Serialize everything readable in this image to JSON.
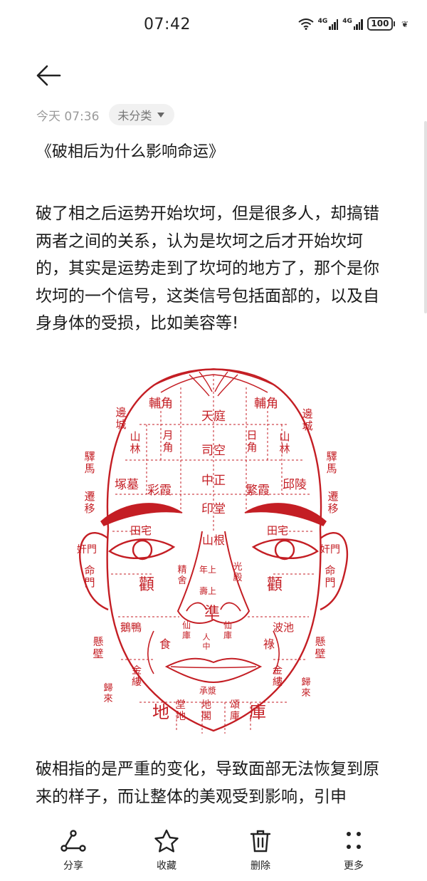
{
  "status_bar": {
    "time": "07:42",
    "network_1": "4G",
    "network_2": "4G",
    "battery": "100",
    "icons": [
      "wifi-icon",
      "signal-icon",
      "signal-icon",
      "battery-icon",
      "leaf-icon"
    ]
  },
  "header": {
    "back_icon": "arrow-left-icon"
  },
  "meta": {
    "timestamp": "今天 07:36",
    "category": "未分类"
  },
  "note": {
    "title": "《破相后为什么影响命运》",
    "paragraph_1": "破了相之后运势开始坎坷，但是很多人，却搞错两者之间的关系，认为是坎坷之后才开始坎坷的，其实是运势走到了坎坷的地方了，那个是你坎坷的一个信号，这类信号包括面部的，以及自身身体的受损，比如美容等!",
    "paragraph_2": "破相指的是严重的变化，导致面部无法恢复到原来的样子，而让整体的美观受到影响，引申",
    "face_chart": {
      "accent_color": "#c41e24",
      "labels": [
        {
          "id": "fujiao-l",
          "text": "輔角"
        },
        {
          "id": "fujiao-r",
          "text": "輔角"
        },
        {
          "id": "biancheng-l",
          "text": "邊城"
        },
        {
          "id": "biancheng-r",
          "text": "邊城"
        },
        {
          "id": "tianting",
          "text": "天庭"
        },
        {
          "id": "shanlin-l",
          "text": "山林"
        },
        {
          "id": "shanlin-r",
          "text": "山林"
        },
        {
          "id": "yuejiao",
          "text": "月角"
        },
        {
          "id": "rijiao",
          "text": "日角"
        },
        {
          "id": "sikong",
          "text": "司空"
        },
        {
          "id": "yima-l",
          "text": "驛馬"
        },
        {
          "id": "yima-r",
          "text": "驛馬"
        },
        {
          "id": "zhongzheng",
          "text": "中正"
        },
        {
          "id": "zhongmu",
          "text": "塚墓"
        },
        {
          "id": "caixia",
          "text": "彩霞"
        },
        {
          "id": "fanxia",
          "text": "繁霞"
        },
        {
          "id": "qiuling",
          "text": "邱陵"
        },
        {
          "id": "qianyi-l",
          "text": "遷移"
        },
        {
          "id": "qianyi-r",
          "text": "遷移"
        },
        {
          "id": "yintang",
          "text": "印堂"
        },
        {
          "id": "tianzhai-l",
          "text": "田宅"
        },
        {
          "id": "tianzhai-r",
          "text": "田宅"
        },
        {
          "id": "shangen",
          "text": "山根"
        },
        {
          "id": "jianmen-l",
          "text": "奸門"
        },
        {
          "id": "jianmen-r",
          "text": "奸門"
        },
        {
          "id": "nianshang",
          "text": "年上"
        },
        {
          "id": "shoushang",
          "text": "壽上"
        },
        {
          "id": "jingshe",
          "text": "精舍"
        },
        {
          "id": "guangdian",
          "text": "光殿"
        },
        {
          "id": "quan-l",
          "text": "顴"
        },
        {
          "id": "quan-r",
          "text": "顴"
        },
        {
          "id": "mingmen-l",
          "text": "命門"
        },
        {
          "id": "mingmen-r",
          "text": "命門"
        },
        {
          "id": "zhun",
          "text": "準"
        },
        {
          "id": "eya",
          "text": "鵝鴨"
        },
        {
          "id": "bochi",
          "text": "波池"
        },
        {
          "id": "shi",
          "text": "食"
        },
        {
          "id": "lu",
          "text": "祿"
        },
        {
          "id": "xianku-l",
          "text": "仙庫"
        },
        {
          "id": "xianku-r",
          "text": "仙庫"
        },
        {
          "id": "renzhong",
          "text": "人中"
        },
        {
          "id": "xuanbi-l",
          "text": "懸壁"
        },
        {
          "id": "xuanbi-r",
          "text": "懸壁"
        },
        {
          "id": "jinlou-l",
          "text": "金縷"
        },
        {
          "id": "jinlou-r",
          "text": "金縷"
        },
        {
          "id": "chengjiang",
          "text": "承漿"
        },
        {
          "id": "kuxi",
          "text": "歸來"
        },
        {
          "id": "guilai",
          "text": "歸來"
        },
        {
          "id": "di",
          "text": "地"
        },
        {
          "id": "tangdi",
          "text": "堂地"
        },
        {
          "id": "dige",
          "text": "地閣"
        },
        {
          "id": "songku",
          "text": "頌庫"
        },
        {
          "id": "ku",
          "text": "庫"
        }
      ]
    }
  },
  "toolbar": {
    "share": {
      "label": "分享",
      "icon": "share-icon"
    },
    "favorite": {
      "label": "收藏",
      "icon": "star-icon"
    },
    "delete": {
      "label": "删除",
      "icon": "trash-icon"
    },
    "more": {
      "label": "更多",
      "icon": "more-dots-icon"
    }
  }
}
